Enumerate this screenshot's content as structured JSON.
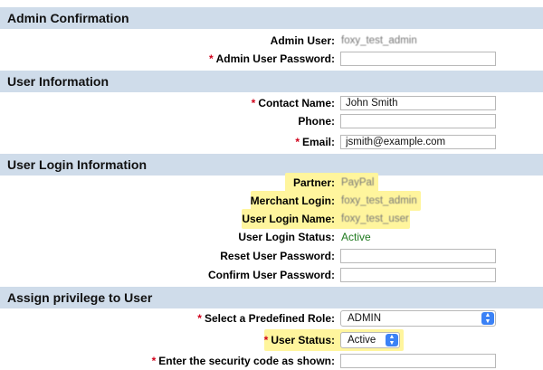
{
  "admin_confirmation": {
    "header": "Admin Confirmation",
    "admin_user_label": "Admin User:",
    "admin_user_value": "foxy_test_admin",
    "admin_password_label": "Admin User Password:",
    "admin_password_value": ""
  },
  "user_information": {
    "header": "User Information",
    "contact_name_label": "Contact Name:",
    "contact_name_value": "John Smith",
    "phone_label": "Phone:",
    "phone_value": "",
    "email_label": "Email:",
    "email_value": "jsmith@example.com"
  },
  "user_login_information": {
    "header": "User Login Information",
    "partner_label": "Partner:",
    "partner_value": "PayPal",
    "merchant_login_label": "Merchant Login:",
    "merchant_login_value": "foxy_test_admin",
    "user_login_name_label": "User Login Name:",
    "user_login_name_value": "foxy_test_user",
    "user_login_status_label": "User Login Status:",
    "user_login_status_value": "Active",
    "reset_password_label": "Reset User Password:",
    "confirm_password_label": "Confirm User Password:"
  },
  "assign_privilege": {
    "header": "Assign privilege to User",
    "role_label": "Select a Predefined Role:",
    "role_value": "ADMIN",
    "user_status_label": "User Status:",
    "user_status_value": "Active",
    "security_code_label": "Enter the security code as shown:"
  },
  "required_marker": "*",
  "icons": {
    "select_arrow": "up-down-chevron-icon"
  },
  "colors": {
    "section_header_bg": "#cfdcea",
    "required": "#d0021b",
    "status_active": "#1f7a1f",
    "highlight": "#fff59d",
    "select_arrow_bg": "#3b82f6"
  }
}
